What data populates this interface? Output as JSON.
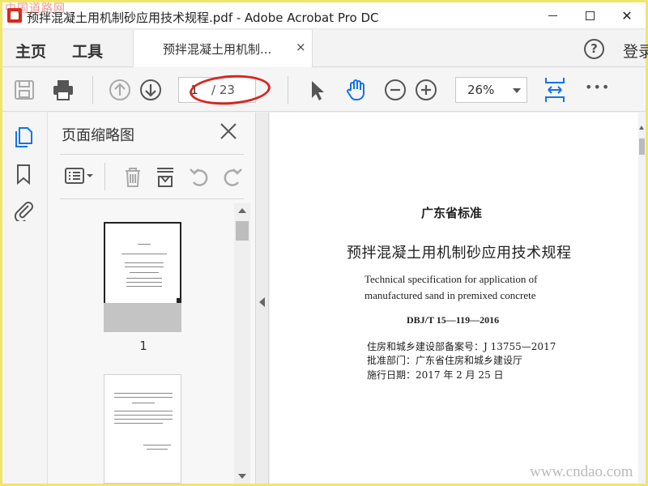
{
  "window": {
    "title": "预拌混凝土用机制砂应用技术规程.pdf - Adobe Acrobat Pro DC",
    "min_icon": "minimize-icon",
    "max_icon": "maximize-icon",
    "close_glyph": "✕"
  },
  "watermark": {
    "top": "中国道路网",
    "bottom": "www.cndao.com"
  },
  "nav": {
    "home": "主页",
    "tools": "工具",
    "doc_tab": "预拌混凝土用机制...",
    "doc_tab_close": "×",
    "help": "?",
    "signin": "登录"
  },
  "toolbar": {
    "icons": [
      "save-icon",
      "print-icon",
      "prev-page-icon",
      "next-page-icon",
      "select-cursor-icon",
      "hand-icon",
      "zoom-out-icon",
      "zoom-in-icon",
      "fit-page-icon",
      "more-icon"
    ],
    "page_current": "1",
    "page_total": "/ 23",
    "zoom": "26%",
    "more": "•••"
  },
  "thumbnails": {
    "title": "页面缩略图",
    "page1_label": "1",
    "tools": [
      "options-icon",
      "delete-icon",
      "extract-icon",
      "rotate-left-icon",
      "rotate-right-icon"
    ]
  },
  "document": {
    "standard": "广东省标准",
    "title_cn": "预拌混凝土用机制砂应用技术规程",
    "title_en_1": "Technical specification for application of",
    "title_en_2": "manufactured sand in premixed concrete",
    "code": "DBJ/T 15—119—2016",
    "filing": "住房和城乡建设部备案号：J 13755—2017",
    "approver": "批准部门：广东省住房和城乡建设厅",
    "date": "施行日期：2017 年 2 月 25 日"
  },
  "colors": {
    "accent": "#1473e6",
    "highlight": "#d8261f",
    "frame": "#f2e56a"
  }
}
